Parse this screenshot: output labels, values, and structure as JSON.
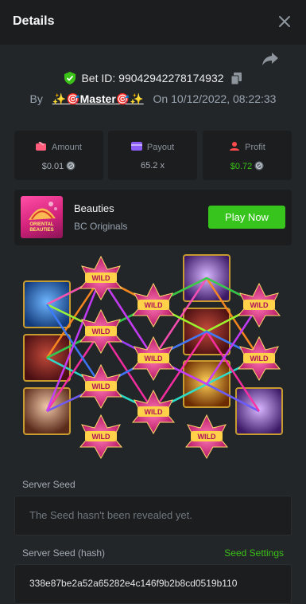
{
  "header": {
    "title": "Details"
  },
  "bet": {
    "label": "Bet ID:",
    "id": "99042942278174932"
  },
  "by": {
    "prefix": "By",
    "user_deco_left": "✨🎯",
    "user_name": "Master",
    "user_deco_right": "🎯✨",
    "on_label": "On",
    "date": "10/12/2022, 08:22:33"
  },
  "stats": [
    {
      "label": "Amount",
      "value": "$0.01",
      "color": "#ff5c7c"
    },
    {
      "label": "Payout",
      "value": "65.2 x",
      "color": "#8b5cf6"
    },
    {
      "label": "Profit",
      "value": "$0.72",
      "color": "#ff4b4b",
      "value_color": "#3bc117"
    }
  ],
  "game": {
    "thumb_text": "ORIENTAL BEAUTIES",
    "name": "Beauties",
    "provider": "BC Originals",
    "play_label": "Play Now"
  },
  "reels": {
    "wild_label": "WILD"
  },
  "server_seed": {
    "label": "Server Seed",
    "value": "The Seed hasn't been revealed yet."
  },
  "server_seed_hash": {
    "label": "Server Seed (hash)",
    "settings_label": "Seed Settings",
    "value": "338e87be2a52a65282e4c146f9b2b8cd0519b110"
  },
  "colors": {
    "accent_green": "#37c41c",
    "panel": "#1b1d1f",
    "background": "#232629"
  }
}
